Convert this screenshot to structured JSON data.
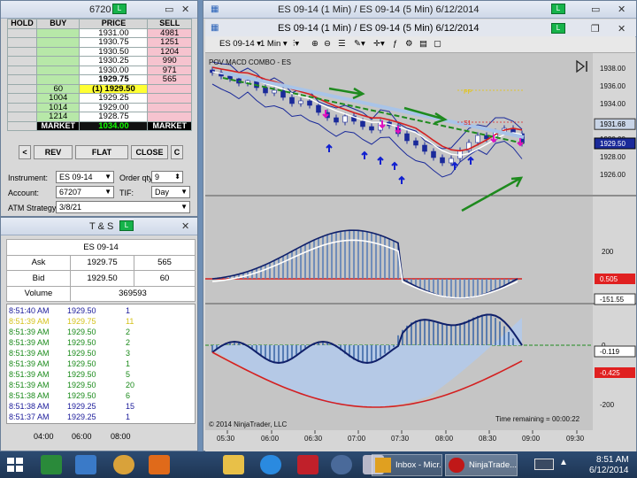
{
  "dom_window": {
    "title": "6720",
    "headers": {
      "hold": "HOLD",
      "buy": "BUY",
      "price": "PRICE",
      "sell": "SELL"
    },
    "rows": [
      {
        "buy": "",
        "price": "1931.00",
        "sell": "4981"
      },
      {
        "buy": "",
        "price": "1930.75",
        "sell": "1251"
      },
      {
        "buy": "",
        "price": "1930.50",
        "sell": "1204"
      },
      {
        "buy": "",
        "price": "1930.25",
        "sell": "990"
      },
      {
        "buy": "",
        "price": "1930.00",
        "sell": "971"
      },
      {
        "buy": "",
        "price": "1929.75",
        "sell": "565"
      },
      {
        "buy": "60",
        "price": "(1) 1929.50",
        "sell": ""
      },
      {
        "buy": "1004",
        "price": "1929.25",
        "sell": ""
      },
      {
        "buy": "1014",
        "price": "1929.00",
        "sell": ""
      },
      {
        "buy": "1214",
        "price": "1928.75",
        "sell": ""
      }
    ],
    "market_row": {
      "left": "MARKET",
      "value": "1034.00",
      "right": "MARKET"
    },
    "buttons": {
      "left_arrow": "<",
      "rev": "REV",
      "flat": "FLAT",
      "close": "CLOSE",
      "c": "C"
    },
    "instrument_label": "Instrument:",
    "instrument_value": "ES 09-14",
    "order_qty_label": "Order qty:",
    "order_qty_value": "9",
    "account_label": "Account:",
    "account_value": "67207",
    "tif_label": "TIF:",
    "tif_value": "Day",
    "atm_label": "ATM Strategy:",
    "atm_value": "3/8/21"
  },
  "ts_window": {
    "title": "T & S",
    "instrument": "ES 09-14",
    "ask_label": "Ask",
    "ask_price": "1929.75",
    "ask_size": "565",
    "bid_label": "Bid",
    "bid_price": "1929.50",
    "bid_size": "60",
    "volume_label": "Volume",
    "volume_value": "369593",
    "trades": [
      {
        "time": "8:51:40 AM",
        "price": "1929.50",
        "size": "1",
        "color": "#1a1a9a"
      },
      {
        "time": "8:51:39 AM",
        "price": "1929.75",
        "size": "11",
        "color": "#d4c21a"
      },
      {
        "time": "8:51:39 AM",
        "price": "1929.50",
        "size": "2",
        "color": "#1a8a1a"
      },
      {
        "time": "8:51:39 AM",
        "price": "1929.50",
        "size": "2",
        "color": "#1a8a1a"
      },
      {
        "time": "8:51:39 AM",
        "price": "1929.50",
        "size": "3",
        "color": "#1a8a1a"
      },
      {
        "time": "8:51:39 AM",
        "price": "1929.50",
        "size": "1",
        "color": "#1a8a1a"
      },
      {
        "time": "8:51:39 AM",
        "price": "1929.50",
        "size": "5",
        "color": "#1a8a1a"
      },
      {
        "time": "8:51:39 AM",
        "price": "1929.50",
        "size": "20",
        "color": "#1a8a1a"
      },
      {
        "time": "8:51:38 AM",
        "price": "1929.50",
        "size": "6",
        "color": "#1a8a1a"
      },
      {
        "time": "8:51:38 AM",
        "price": "1929.25",
        "size": "15",
        "color": "#1a1a9a"
      },
      {
        "time": "8:51:37 AM",
        "price": "1929.25",
        "size": "1",
        "color": "#1a1a9a"
      }
    ],
    "bottom_times": [
      "04:00",
      "06:00",
      "08:00"
    ]
  },
  "chart_window": {
    "title1": "ES 09-14 (1 Min) / ES 09-14 (5 Min)  6/12/2014",
    "title2": "ES 09-14 (1 Min) / ES 09-14 (5 Min)  6/12/2014",
    "toolbar_instrument": "ES 09-14",
    "toolbar_interval": "1 Min",
    "indicator_label": "POV MACD COMBO - ES",
    "pp_label": "PP",
    "s1_label": "S1",
    "copyright": "© 2014 NinjaTrader, LLC",
    "time_remaining": "Time remaining = 00:00:22"
  },
  "chart_data": {
    "type": "line",
    "price_axis": [
      "1938.00",
      "1936.00",
      "1934.00",
      "1932.00",
      "1930.00",
      "1928.00",
      "1926.00"
    ],
    "price_markers": {
      "upper": "1931.68",
      "current": "1929.50"
    },
    "macd_axis": [
      "200"
    ],
    "macd_markers": {
      "red": "0.505",
      "white": "-151.55"
    },
    "osc_axis": [
      "0",
      "-200"
    ],
    "osc_markers": {
      "white": "-0.119",
      "red": "-0.425"
    },
    "x_ticks": [
      "05:30",
      "06:00",
      "06:30",
      "07:00",
      "07:30",
      "08:00",
      "08:30",
      "09:00",
      "09:30"
    ],
    "price_close": [
      1937.5,
      1937.1,
      1936.8,
      1936.3,
      1936.6,
      1935.8,
      1935.2,
      1935.5,
      1934.7,
      1934.0,
      1934.3,
      1933.8,
      1933.0,
      1932.4,
      1931.9,
      1932.6,
      1932.0,
      1931.4,
      1931.0,
      1931.9,
      1931.5,
      1930.6,
      1929.8,
      1929.3,
      1928.6,
      1927.9,
      1927.3,
      1927.8,
      1928.7,
      1929.6,
      1930.4,
      1930.0,
      1930.8,
      1931.2,
      1930.6,
      1929.5
    ]
  },
  "taskbar": {
    "inbox_label": "Inbox - Micr...",
    "ninja_label": "NinjaTrade...",
    "clock_time": "8:51 AM",
    "clock_date": "6/12/2014"
  },
  "colors": {
    "buy_green": "#b7e8a8",
    "sell_pink": "#f6c3cf",
    "chart_bg": "#c5c5c5",
    "accent_green": "#16b34a"
  }
}
